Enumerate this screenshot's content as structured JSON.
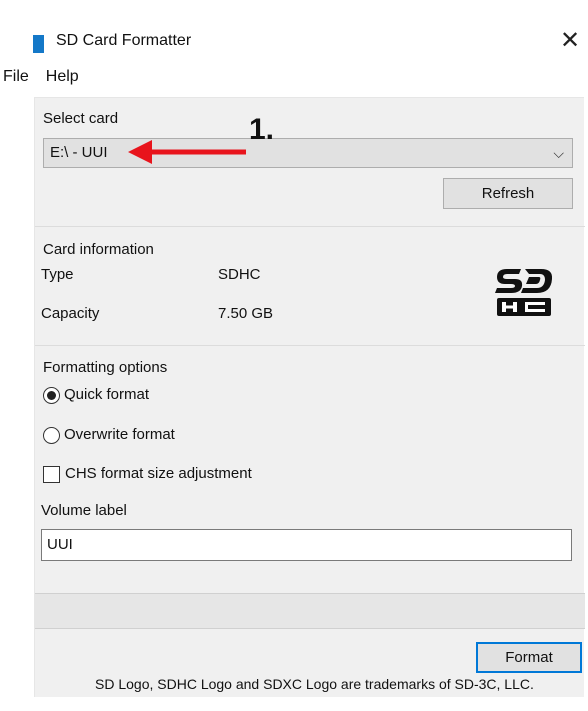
{
  "window": {
    "title": "SD Card Formatter",
    "close_glyph": "✕",
    "accent_color": "#1478c8"
  },
  "menu": {
    "items": [
      {
        "label": "File"
      },
      {
        "label": "Help"
      }
    ]
  },
  "select_card": {
    "group_label": "Select card",
    "selected": "E:\\ - UUI",
    "refresh_label": "Refresh"
  },
  "card_info": {
    "group_label": "Card information",
    "type_label": "Type",
    "type_value": "SDHC",
    "capacity_label": "Capacity",
    "capacity_value": "7.50 GB",
    "logo_icon": "sdhc-logo-icon"
  },
  "formatting": {
    "group_label": "Formatting options",
    "quick_label": "Quick format",
    "quick_selected": true,
    "overwrite_label": "Overwrite format",
    "overwrite_selected": false,
    "chs_label": "CHS format size adjustment",
    "chs_checked": false,
    "volume_label_caption": "Volume label",
    "volume_label_value": "UUI"
  },
  "progress": {
    "fraction": 0
  },
  "actions": {
    "format_label": "Format"
  },
  "footer": {
    "trademark": "SD Logo, SDHC Logo and SDXC Logo are trademarks of SD-3C, LLC."
  },
  "annotation": {
    "label": "1.",
    "color": "#e8141c"
  }
}
